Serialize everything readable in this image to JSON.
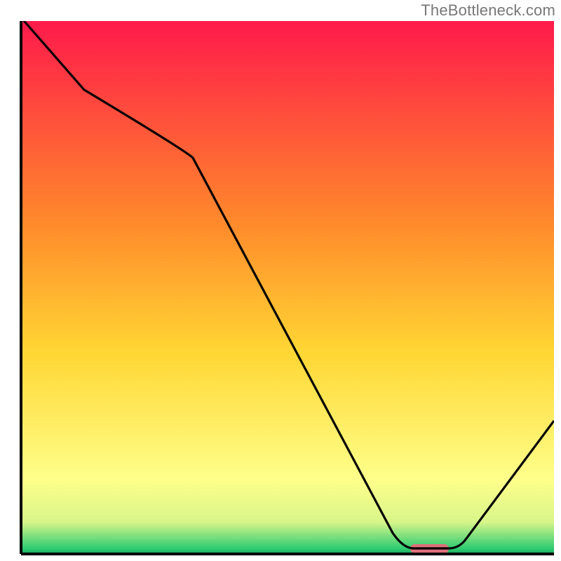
{
  "watermark": "TheBottleneck.com",
  "colors": {
    "axis": "#000000",
    "curve": "#000000",
    "gradient_top": "#ff1a4b",
    "gradient_mid1": "#ff8a2b",
    "gradient_mid2": "#ffd633",
    "gradient_low": "#ffff99",
    "gradient_green": "#2ecc71",
    "marker": "#e0707a"
  },
  "chart_data": {
    "type": "line",
    "title": "",
    "xlabel": "",
    "ylabel": "",
    "xlim": [
      0,
      100
    ],
    "ylim": [
      0,
      100
    ],
    "x": [
      0,
      12,
      32,
      70,
      73,
      80,
      82,
      100
    ],
    "values": [
      100,
      87,
      77,
      3,
      1,
      1,
      2,
      24
    ],
    "optimal_range_x": [
      73,
      80
    ],
    "annotations": []
  }
}
